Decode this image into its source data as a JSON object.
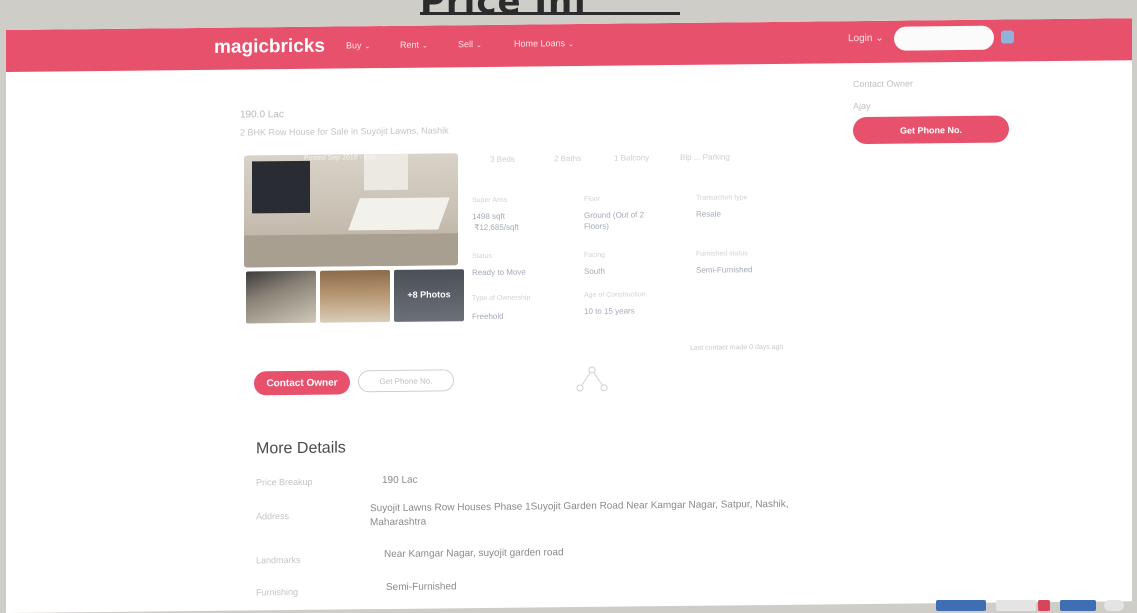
{
  "caption": {
    "text": "Price Inf"
  },
  "nav": {
    "logo": "magicbricks",
    "items": [
      {
        "label": "Buy"
      },
      {
        "label": "Rent"
      },
      {
        "label": "Sell"
      },
      {
        "label": "Home Loans"
      }
    ],
    "login": "Login",
    "search_placeholder": ""
  },
  "listing": {
    "price": "190.0 Lac",
    "subtitle": "2 BHK Row House for Sale in Suyojit Lawns, Nashik",
    "photo_caption": "Posted Sep 2018 · Exc.",
    "more_photos": "+8 Photos",
    "tabs": [
      "3 Beds",
      "2 Baths",
      "1 Balcony",
      "Blp ... Parking"
    ],
    "attributes": [
      {
        "label": "Super Area",
        "value": "1498 sqft\n ₹12,685/sqft"
      },
      {
        "label": "Floor",
        "value": "Ground (Out of 2\nFloors)"
      },
      {
        "label": "Transaction type",
        "value": "Resale"
      },
      {
        "label": "Status",
        "value": "Ready to Move"
      },
      {
        "label": "Facing",
        "value": "South"
      },
      {
        "label": "Furnished status",
        "value": "Semi-Furnished"
      },
      {
        "label": "Type of Ownership",
        "value": "Freehold"
      },
      {
        "label": "Age of Construction",
        "value": "10 to 15 years"
      }
    ],
    "contact_owner": "Contact Owner",
    "get_phone": "Get Phone No.",
    "last_contact": "Last contact made 0 days ago"
  },
  "sidebar": {
    "contact_label": "Contact Owner",
    "contact_name": "Ajay",
    "get_phone": "Get Phone No."
  },
  "more_details": {
    "title": "More Details",
    "rows": [
      {
        "label": "Price Breakup",
        "value": "190 Lac"
      },
      {
        "label": "Address",
        "value": "Suyojit Lawns Row Houses Phase 1Suyojit Garden Road Near Kamgar Nagar, Satpur, Nashik, Maharashtra"
      },
      {
        "label": "Landmarks",
        "value": "Near Kamgar Nagar, suyojit garden road"
      },
      {
        "label": "Furnishing",
        "value": "Semi-Furnished"
      }
    ]
  },
  "colors": {
    "brand": "#e8516b",
    "nav_text": "#fde3e7"
  }
}
